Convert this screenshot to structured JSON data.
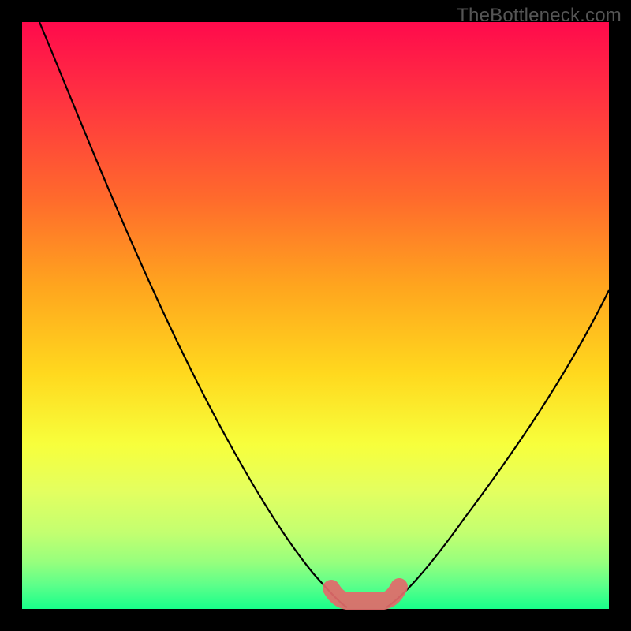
{
  "watermark": "TheBottleneck.com",
  "colors": {
    "background_frame": "#000000",
    "gradient_top": "#ff0a4c",
    "gradient_mid1": "#ff6a2c",
    "gradient_mid2": "#ffd91e",
    "gradient_bottom": "#18ff8a",
    "curve": "#000000",
    "highlight_band": "#e26b6b"
  },
  "chart_data": {
    "type": "line",
    "title": "",
    "xlabel": "",
    "ylabel": "",
    "xlim": [
      0,
      100
    ],
    "ylim": [
      0,
      100
    ],
    "series": [
      {
        "name": "left-branch",
        "x": [
          3,
          10,
          18,
          26,
          34,
          42,
          48,
          52,
          55
        ],
        "y": [
          100,
          84,
          68,
          53,
          38,
          24,
          12,
          4,
          0
        ]
      },
      {
        "name": "right-branch",
        "x": [
          62,
          66,
          72,
          80,
          88,
          96,
          100
        ],
        "y": [
          0,
          4,
          12,
          24,
          37,
          49,
          55
        ]
      },
      {
        "name": "valley-highlight",
        "x": [
          52,
          55,
          58,
          62,
          65
        ],
        "y": [
          3,
          0,
          0,
          0,
          3
        ]
      }
    ],
    "annotations": []
  }
}
